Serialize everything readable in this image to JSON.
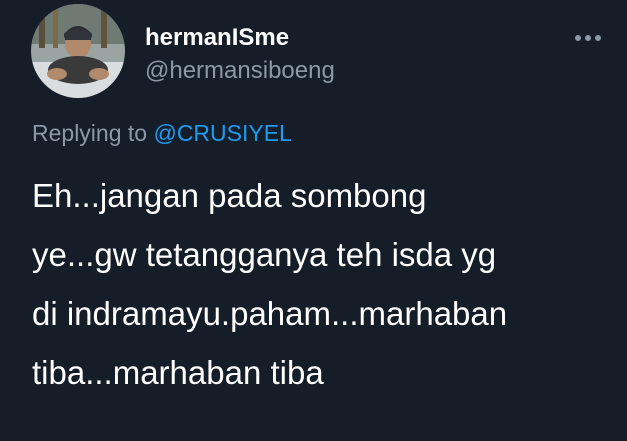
{
  "author": {
    "display_name": "hermanISme",
    "handle": "@hermansiboeng",
    "avatar_icon": "user-avatar"
  },
  "menu": {
    "icon": "more-options-icon"
  },
  "reply": {
    "prefix": "Replying to",
    "mention": "@CRUSIYEL"
  },
  "tweet": {
    "lines": [
      "Eh...jangan pada sombong",
      "ye...gw tetangganya teh isda yg",
      "di indramayu.paham...marhaban",
      "tiba...marhaban tiba"
    ]
  },
  "colors": {
    "background": "#151d29",
    "primary_text": "#ffffff",
    "secondary_text": "#8b98a5",
    "link": "#1d9bf0"
  }
}
